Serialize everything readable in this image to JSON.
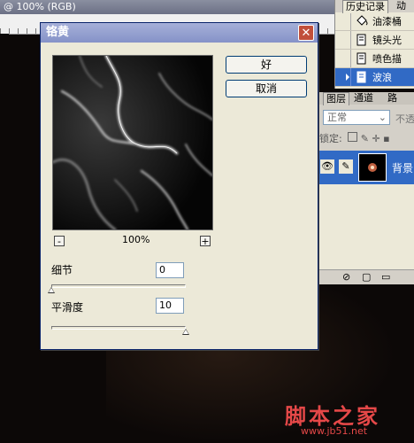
{
  "document": {
    "title": "@ 100% (RGB)"
  },
  "dialog": {
    "title": "铬黄",
    "close_label": "✕",
    "ok_label": "好",
    "cancel_label": "取消",
    "zoom": {
      "minus_label": "-",
      "plus_label": "+",
      "level": "100%"
    },
    "detail": {
      "label": "细节",
      "value": "0",
      "slider_fraction": 0.0
    },
    "smoothness": {
      "label": "平滑度",
      "value": "10",
      "slider_fraction": 1.0
    }
  },
  "history": {
    "tabs": [
      "历史记录",
      "动"
    ],
    "items": [
      {
        "label": "油漆桶",
        "icon": "paint-bucket-icon"
      },
      {
        "label": "镜头光",
        "icon": "document-icon"
      },
      {
        "label": "喷色描",
        "icon": "document-icon"
      },
      {
        "label": "波浪",
        "icon": "document-icon",
        "selected": true
      }
    ]
  },
  "layers": {
    "tabs": [
      "图层",
      "通道",
      "路"
    ],
    "blend_mode": "正常",
    "opacity_label": "不透",
    "lock_label": "锁定:",
    "layer_name": "背景"
  },
  "watermark": {
    "text": "脚本之家",
    "url": "www.jb51.net"
  },
  "colors": {
    "dialog_bg": "#ece9d8",
    "title_bar": "#8592c8",
    "selection": "#316ac5",
    "close_red": "#c14f3a",
    "watermark": "#e54848"
  }
}
